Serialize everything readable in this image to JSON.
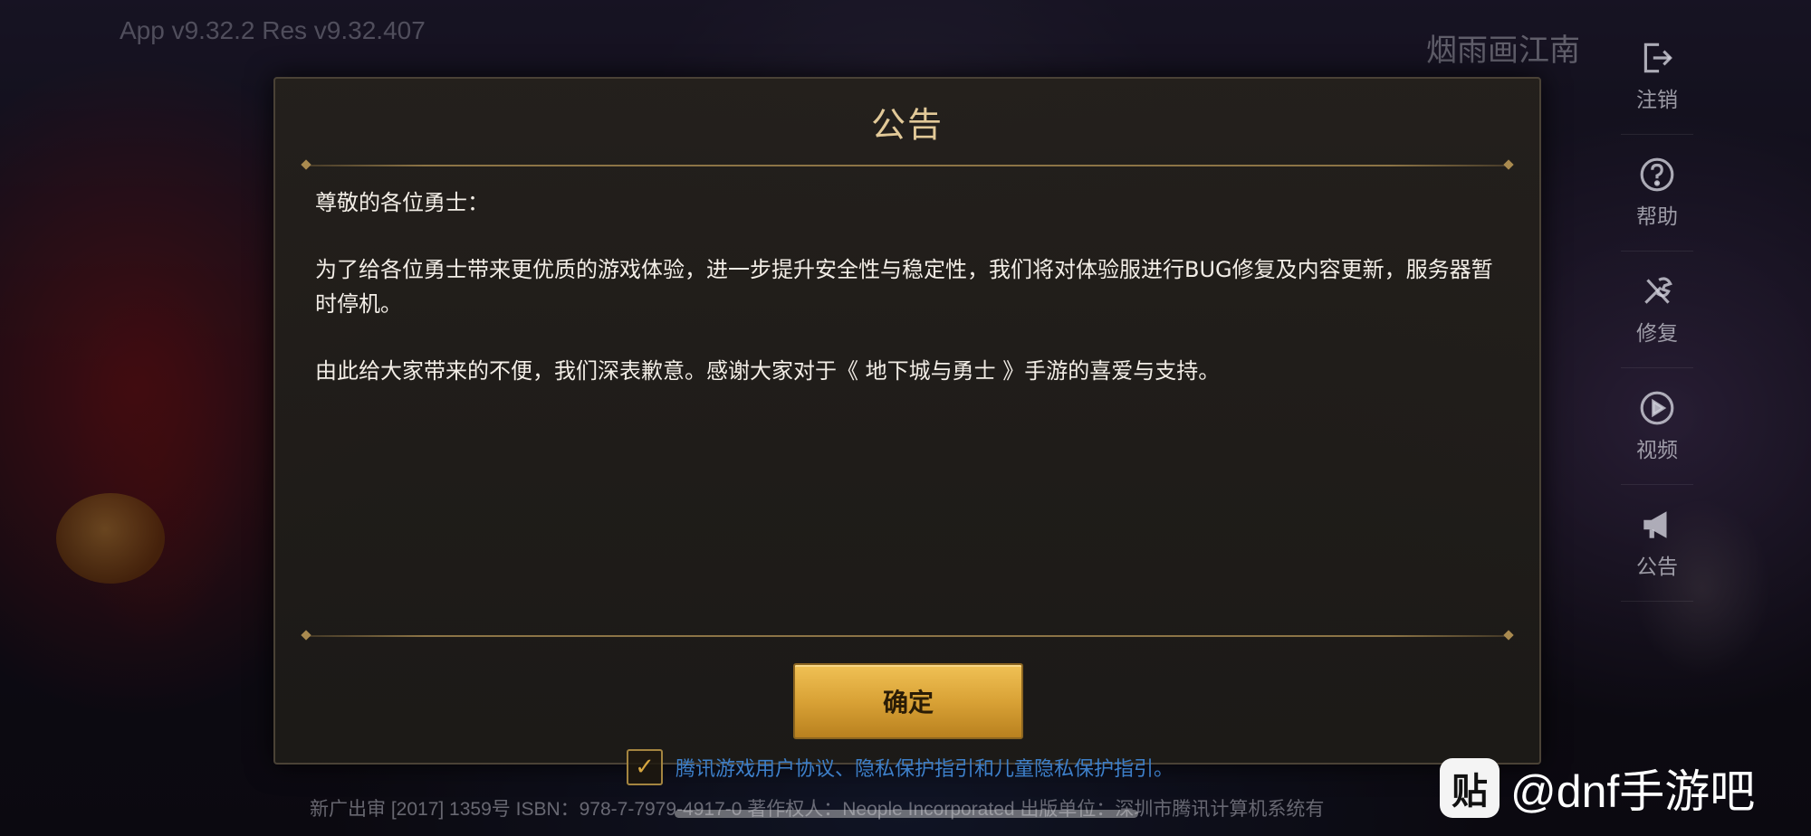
{
  "version_text": "App v9.32.2 Res v9.32.407",
  "server_name": "烟雨画江南",
  "side_menu": {
    "items": [
      {
        "label": "注销",
        "icon": "logout-icon"
      },
      {
        "label": "帮助",
        "icon": "help-icon"
      },
      {
        "label": "修复",
        "icon": "repair-icon"
      },
      {
        "label": "视频",
        "icon": "video-play-icon"
      },
      {
        "label": "公告",
        "icon": "announcement-icon"
      }
    ]
  },
  "dialog": {
    "title": "公告",
    "greeting": "尊敬的各位勇士：",
    "paragraph1": "为了给各位勇士带来更优质的游戏体验，进一步提升安全性与稳定性，我们将对体验服进行BUG修复及内容更新，服务器暂时停机。",
    "paragraph2": "由此给大家带来的不便，我们深表歉意。感谢大家对于《 地下城与勇士 》手游的喜爱与支持。",
    "confirm_label": "确定"
  },
  "footer": {
    "agreement_text": "腾讯游戏用户协议、隐私保护指引和儿童隐私保护指引。",
    "isbn_text": "新广出审 [2017] 1359号 ISBN：978-7-7979-4917-0 著作权人：Neople Incorporated 出版单位：深圳市腾讯计算机系统有"
  },
  "watermark": {
    "logo": "贴",
    "text": "@dnf手游吧"
  },
  "colors": {
    "title_gold": "#e2c998",
    "button_gold": "#d9a236",
    "link_blue": "#3d7fc9"
  }
}
